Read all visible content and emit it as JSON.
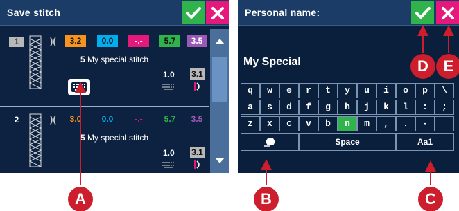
{
  "left_screen": {
    "title": "Save stitch",
    "rows": [
      {
        "number": "1",
        "values": [
          "3.2",
          "0.0",
          "-.-",
          "5.7",
          "3.5"
        ],
        "name_number": "5",
        "name_text": "My special stitch",
        "length_value": "1.0",
        "box_value": "3.1",
        "selected": true
      },
      {
        "number": "2",
        "values": [
          "3.0",
          "0.0",
          "-.-",
          "5.7",
          "3.5"
        ],
        "name_number": "5",
        "name_text": "My special stitch",
        "length_value": "1.0",
        "box_value": "3.1",
        "selected": false
      }
    ],
    "value_colors": [
      "#f7941d",
      "#00aeef",
      "#e5197c",
      "#2fb34a",
      "#9b59b6"
    ]
  },
  "right_screen": {
    "title": "Personal name:",
    "name_value": "My Special",
    "keyboard_rows": [
      [
        "q",
        "w",
        "e",
        "r",
        "t",
        "y",
        "u",
        "i",
        "o",
        "p",
        "\\"
      ],
      [
        "a",
        "s",
        "d",
        "f",
        "g",
        "h",
        "j",
        "k",
        "l",
        ":",
        ";"
      ],
      [
        "z",
        "x",
        "c",
        "v",
        "b",
        "n",
        "m",
        ",",
        ".",
        "-",
        "_"
      ]
    ],
    "highlighted_key": "n",
    "space_label": "Space",
    "case_label": "Aa1"
  },
  "callouts": {
    "a": "A",
    "b": "B",
    "c": "C",
    "d": "D",
    "e": "E"
  },
  "colors": {
    "ok_green": "#2fb34a",
    "cancel_pink": "#e5197c",
    "callout_red": "#cc1e2d",
    "screen_bg": "#0d2240"
  }
}
